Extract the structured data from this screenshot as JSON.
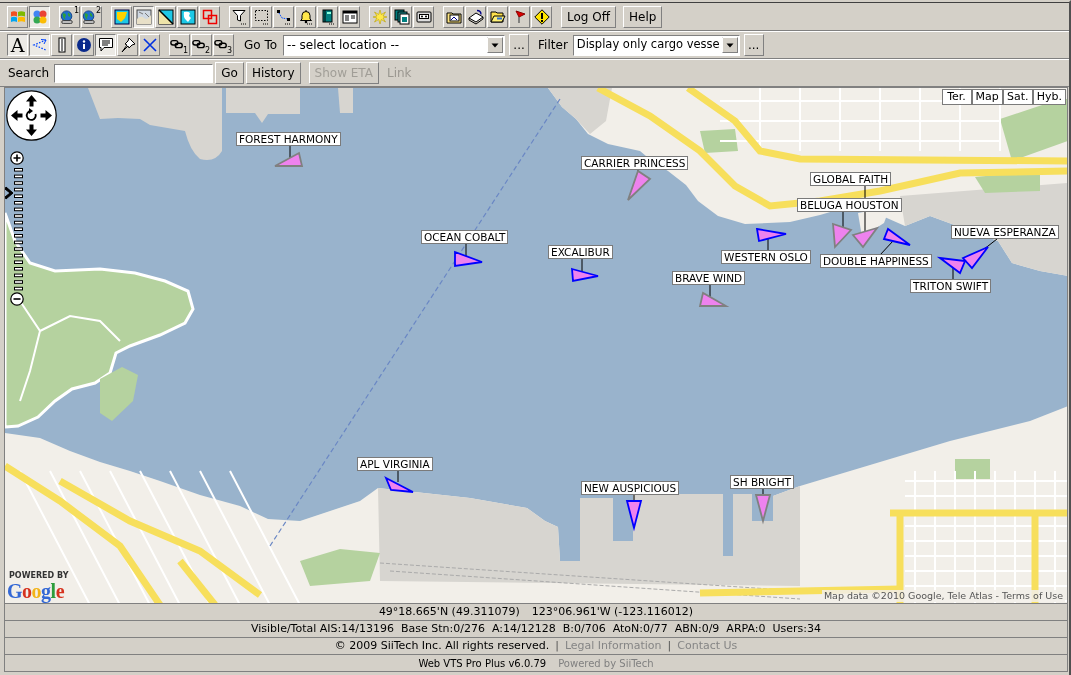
{
  "toolbar": {
    "groups": [
      [
        {
          "kind": "flag4",
          "pressed": false
        },
        {
          "kind": "dots",
          "pressed": true
        }
      ],
      [
        {
          "kind": "globe",
          "pressed": false,
          "badge": "1"
        },
        {
          "kind": "globe",
          "pressed": false,
          "badge": "2"
        }
      ],
      [
        {
          "kind": "chart",
          "pressed": false
        },
        {
          "kind": "map",
          "pressed": true
        },
        {
          "kind": "split",
          "pressed": false
        },
        {
          "kind": "world",
          "pressed": false
        },
        {
          "kind": "overlap",
          "pressed": false
        }
      ],
      [
        {
          "kind": "filter",
          "pressed": false
        },
        {
          "kind": "marquee",
          "pressed": false
        },
        {
          "kind": "route",
          "pressed": false
        },
        {
          "kind": "bell",
          "pressed": false
        },
        {
          "kind": "book",
          "pressed": false
        },
        {
          "kind": "panel",
          "pressed": false
        }
      ],
      [
        {
          "kind": "sun",
          "pressed": false
        },
        {
          "kind": "pages",
          "pressed": false
        },
        {
          "kind": "tape",
          "pressed": false
        }
      ],
      [
        {
          "kind": "folder",
          "pressed": false
        },
        {
          "kind": "disk",
          "pressed": false
        },
        {
          "kind": "openfolder",
          "pressed": false
        },
        {
          "kind": "flag",
          "pressed": false
        },
        {
          "kind": "warning",
          "pressed": false
        }
      ]
    ],
    "buttons": [
      "Log Off",
      "Help"
    ]
  },
  "toolbar_2": {
    "groups": [
      [
        {
          "kind": "letter",
          "label": "A",
          "pressed": true
        },
        {
          "kind": "dotted",
          "pressed": true
        },
        {
          "kind": "ruler",
          "pressed": false
        },
        {
          "kind": "info",
          "pressed": false
        },
        {
          "kind": "bubble",
          "pressed": true
        },
        {
          "kind": "pin",
          "pressed": false
        },
        {
          "kind": "cross",
          "pressed": false
        }
      ],
      [
        {
          "kind": "chain",
          "pressed": false,
          "badge": "1"
        },
        {
          "kind": "chain",
          "pressed": false,
          "badge": "2"
        },
        {
          "kind": "chain",
          "pressed": false,
          "badge": "3"
        }
      ]
    ],
    "go_to": {
      "label": "Go To",
      "value": "-- select location --",
      "more": "..."
    },
    "filter": {
      "label": "Filter",
      "value": "Display only cargo vesse",
      "more": "..."
    }
  },
  "search_bar": {
    "label": "Search",
    "buttons": [
      {
        "label": "Go",
        "disabled": false
      },
      {
        "label": "History",
        "disabled": false
      },
      {
        "label": "Show ETA",
        "disabled": true
      }
    ],
    "link": {
      "label": "Link",
      "disabled": true
    }
  },
  "map": {
    "map_types": [
      "Ter.",
      "Map",
      "Sat.",
      "Hyb."
    ],
    "zoom": {
      "level": 0.83
    },
    "vessels": [
      {
        "name": "FOREST HARMONY",
        "color": "#808080"
      },
      {
        "name": "CARRIER PRINCESS",
        "color": "#808080"
      },
      {
        "name": "GLOBAL FAITH",
        "color": "#808080"
      },
      {
        "name": "BELUGA HOUSTON",
        "color": "#808080"
      },
      {
        "name": "NUEVA ESPERANZA",
        "color": "#0000ff"
      },
      {
        "name": "OCEAN COBALT",
        "color": "#0000ff"
      },
      {
        "name": "EXCALIBUR",
        "color": "#0000ff"
      },
      {
        "name": "WESTERN OSLO",
        "color": "#0000ff"
      },
      {
        "name": "DOUBLE HAPPINESS",
        "color": "#0000ff"
      },
      {
        "name": "BRAVE WIND",
        "color": "#808080"
      },
      {
        "name": "TRITON SWIFT",
        "color": "#0000ff"
      },
      {
        "name": "APL VIRGINIA",
        "color": "#0000ff"
      },
      {
        "name": "SH BRIGHT",
        "color": "#808080"
      },
      {
        "name": "NEW AUSPICIOUS",
        "color": "#0000ff"
      }
    ],
    "logo": {
      "caption": "POWERED BY",
      "name": "Google"
    },
    "attribution": {
      "text": "Map data ©2010 Google, Tele Atlas -",
      "link": "Terms of Use"
    }
  },
  "status_bar": {
    "coordinates": [
      "49°18.665'N (49.311079)",
      "123°06.961'W (-123.116012)"
    ],
    "stats": [
      "Visible/Total AIS:14/13196",
      "Base Stn:0/276",
      "A:14/12128",
      "B:0/706",
      "AtoN:0/77",
      "ABN:0/9",
      "ARPA:0",
      "Users:34"
    ]
  },
  "footer": {
    "items": [
      {
        "kind": "text",
        "text": "© 2009 SiiTech Inc. All rights reserved."
      },
      {
        "kind": "separator",
        "text": "|"
      },
      {
        "kind": "link",
        "text": "Legal Information"
      },
      {
        "kind": "separator",
        "text": "|"
      },
      {
        "kind": "link",
        "text": "Contact Us"
      }
    ],
    "version": "Web VTS Pro Plus v6.0.79",
    "powered_by": "Powered by SiiTech"
  }
}
